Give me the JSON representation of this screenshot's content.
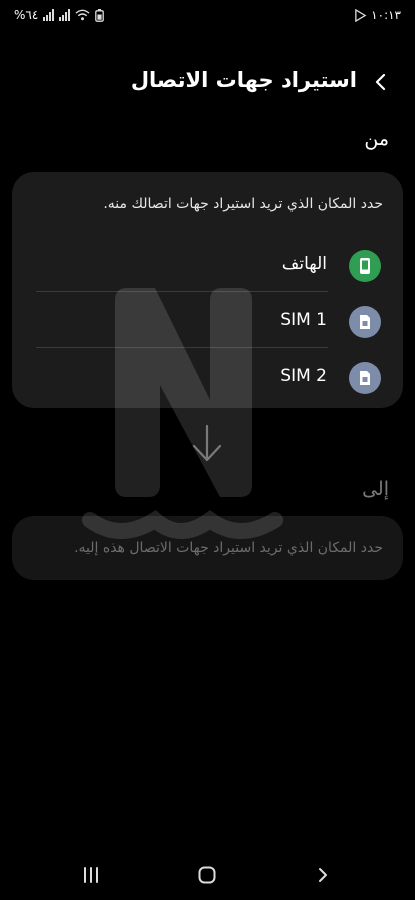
{
  "status_bar": {
    "time": "١٠:١٣",
    "battery": "%٦٤"
  },
  "header": {
    "title": "استيراد جهات الاتصال",
    "back_icon": "chevron-left-icon"
  },
  "from_section": {
    "label": "من",
    "hint": "حدد المكان الذي تريد استيراد جهات اتصالك منه.",
    "sources": [
      {
        "label": "الهاتف",
        "icon": "phone-icon",
        "color": "#2f9e52"
      },
      {
        "label": "SIM 1",
        "icon": "sim-card-icon",
        "color": "#7d8ca8"
      },
      {
        "label": "SIM 2",
        "icon": "sim-card-icon",
        "color": "#7d8ca8"
      }
    ]
  },
  "to_section": {
    "label": "إلى",
    "hint": "حدد المكان الذي تريد استيراد جهات الاتصال هذه إليه."
  },
  "nav_bar": {
    "recents_icon": "recents-icon",
    "home_icon": "home-icon",
    "back_icon": "back-chevron-icon"
  }
}
